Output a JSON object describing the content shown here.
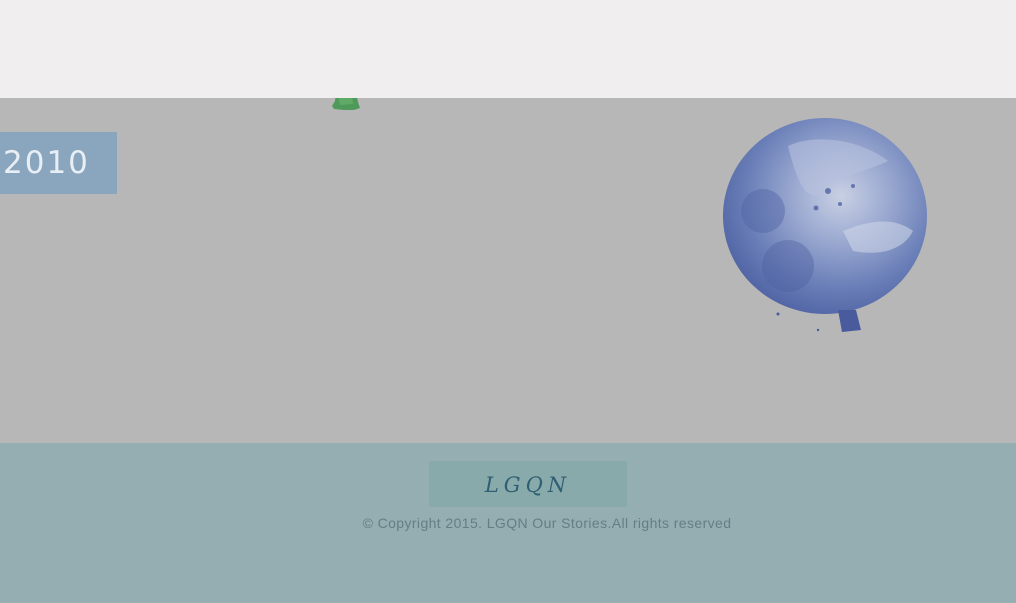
{
  "timeline": {
    "year": "2010"
  },
  "decorations": {
    "green_balloon_icon": "green-balloon-icon",
    "blue_balloon_icon": "blue-balloon-icon"
  },
  "footer": {
    "logo_text": "LGQN",
    "copyright": "© Copyright 2015. LGQN Our Stories.All rights reserved"
  },
  "colors": {
    "top_bar": "#f0eeef",
    "main_background": "#b7b7b7",
    "year_tab": "#89a6be",
    "footer_background": "#95aeb1",
    "footer_logo_background": "#89aaab",
    "balloon_blue": "#6f86b8",
    "balloon_green": "#4f9a5a"
  }
}
